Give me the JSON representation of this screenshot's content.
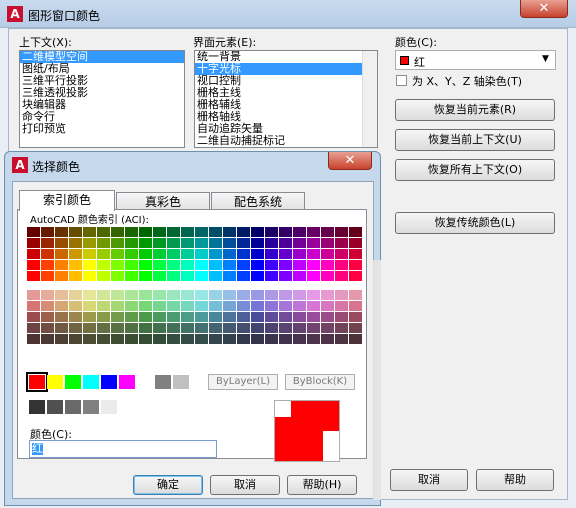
{
  "outer": {
    "title": "图形窗口颜色",
    "close_glyph": "✕",
    "icon_letter": "A",
    "context_label": "上下文(X):",
    "context_items": [
      "二维模型空间",
      "图纸/布局",
      "三维平行投影",
      "三维透视投影",
      "块编辑器",
      "命令行",
      "打印预览"
    ],
    "element_label": "界面元素(E):",
    "element_items": [
      "统一背景",
      "十字光标",
      "视口控制",
      "栅格主线",
      "栅格辅线",
      "栅格轴线",
      "自动追踪矢量",
      "二维自动捕捉标记"
    ],
    "color_label": "颜色(C):",
    "color_value": "红",
    "color_swatch": "#ff0000",
    "tint_checkbox_label": "为 X、Y、Z 轴染色(T)",
    "buttons": {
      "restore_element": "恢复当前元素(R)",
      "restore_context": "恢复当前上下文(U)",
      "restore_all": "恢复所有上下文(O)",
      "restore_classic": "恢复传统颜色(L)",
      "cancel": "取消",
      "help": "帮助"
    }
  },
  "dialog": {
    "title": "选择颜色",
    "close_glyph": "✕",
    "icon_letter": "A",
    "tabs": [
      "索引颜色",
      "真彩色",
      "配色系统"
    ],
    "active_tab": "索引颜色",
    "palette_label": "AutoCAD 颜色索引 (ACI):",
    "bylayer_label": "ByLayer(L)",
    "byblock_label": "ByBlock(K)",
    "color_field_label": "颜色(C):",
    "color_field_value": "红",
    "selected_color": "#ff0000",
    "standard_colors": [
      "#ff0000",
      "#ffff00",
      "#00ff00",
      "#00ffff",
      "#0000ff",
      "#ff00ff",
      "#ffffff",
      "#808080",
      "#c0c0c0"
    ],
    "gray_shades": [
      "#333333",
      "#505050",
      "#696969",
      "#808080",
      "#ebebeb",
      "#ffffff"
    ],
    "buttons": {
      "ok": "确定",
      "cancel": "取消",
      "help": "帮助(H)"
    }
  }
}
